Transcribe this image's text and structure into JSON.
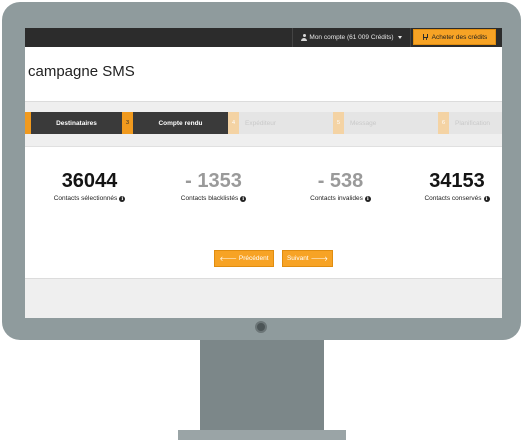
{
  "topbar": {
    "account_label": "Mon compte (61 009 Crédits)",
    "buy_label": "Acheter des crédits"
  },
  "page": {
    "title": "campagne SMS"
  },
  "steps": [
    {
      "number": "",
      "label": "Destinataires",
      "state": "active"
    },
    {
      "number": "3",
      "label": "Compte rendu",
      "state": "active"
    },
    {
      "number": "4",
      "label": "Expéditeur",
      "state": "inactive"
    },
    {
      "number": "5",
      "label": "Message",
      "state": "inactive"
    },
    {
      "number": "6",
      "label": "Planification",
      "state": "inactive"
    }
  ],
  "stats": [
    {
      "value": "36044",
      "label": "Contacts sélectionnés"
    },
    {
      "value": "- 1353",
      "label": "Contacts blacklistés"
    },
    {
      "value": "- 538",
      "label": "Contacts invalides"
    },
    {
      "value": "34153",
      "label": "Contacts conservés"
    }
  ],
  "nav": {
    "previous_label": "Précédent",
    "next_label": "Suivant"
  },
  "icons": {
    "account": "user-icon",
    "buy": "cart-icon",
    "info": "info-icon",
    "previous": "arrow-left-icon",
    "next": "arrow-right-icon"
  },
  "colors": {
    "accent": "#f7a325",
    "topbar": "#2c2c2c",
    "step_active": "#3a3a3a",
    "monitor": "#8f9b9d"
  }
}
